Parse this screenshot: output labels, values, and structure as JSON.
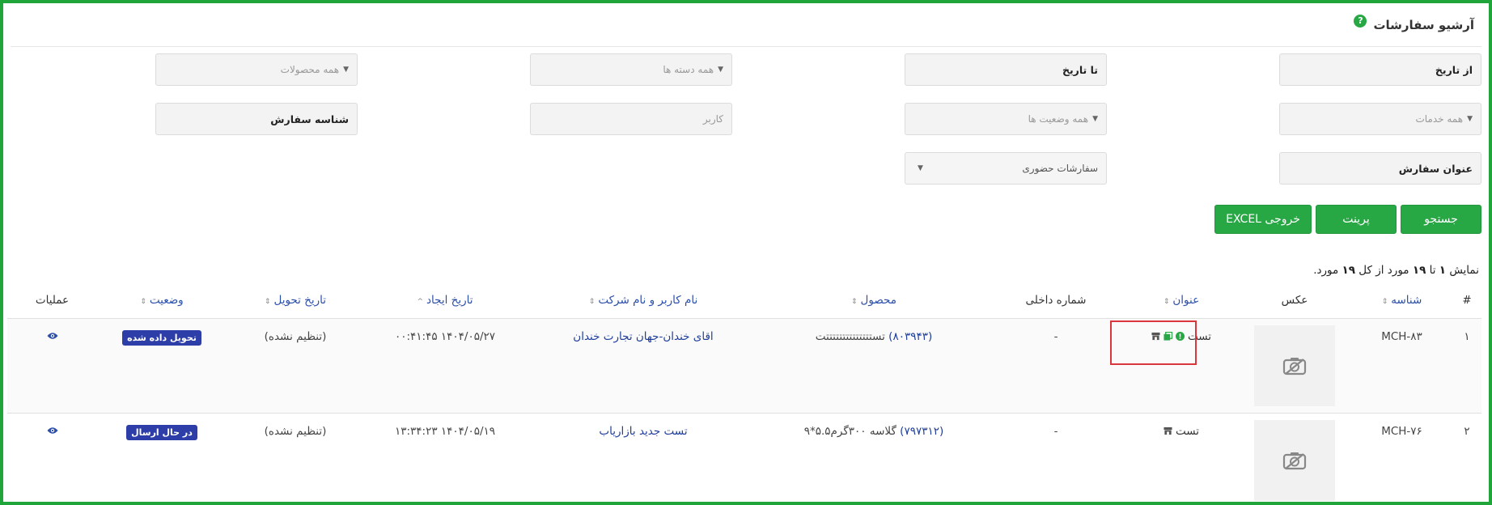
{
  "page": {
    "title": "آرشیو سفارشات",
    "help_icon": "?"
  },
  "filters": {
    "from_date": "از تاریخ",
    "to_date": "تا تاریخ",
    "categories": "همه دسته ها",
    "products": "همه محصولات",
    "services": "همه خدمات",
    "statuses": "همه وضعیت ها",
    "user": "کاربر",
    "order_id": "شناسه سفارش",
    "order_title": "عنوان سفارش",
    "order_type": "سفارشات حضوری"
  },
  "buttons": {
    "search": "جستجو",
    "print": "پرینت",
    "excel": "خروجی EXCEL"
  },
  "summary": {
    "prefix": "نمایش",
    "from": "۱",
    "to_word": "تا",
    "to": "۱۹",
    "mid": "مورد از کل",
    "total": "۱۹",
    "suffix": "مورد."
  },
  "table": {
    "headers": {
      "num": "#",
      "id": "شناسه",
      "photo": "عکس",
      "title": "عنوان",
      "internal_no": "شماره داخلی",
      "product": "محصول",
      "user_company": "نام کاربر و نام شرکت",
      "created": "تاریخ ایجاد",
      "delivery": "تاریخ تحویل",
      "status": "وضعیت",
      "actions": "عملیات"
    },
    "rows": [
      {
        "num": "۱",
        "id": "MCH-۸۳",
        "title": "تست",
        "internal_no": "-",
        "product_code": "(۸۰۳۹۴۳)",
        "product_name": "تستتتتتتتتتتتتتتت",
        "user_company": "اقای خندان-جهان تجارت خندان",
        "created": "۱۴۰۴/۰۵/۲۷ ۰۰:۴۱:۴۵",
        "delivery": "(تنظیم نشده)",
        "status": "تحویل داده شده"
      },
      {
        "num": "۲",
        "id": "MCH-۷۶",
        "title": "تست",
        "internal_no": "-",
        "product_code": "(۷۹۷۳۱۲)",
        "product_name": "گلاسه ۳۰۰گرم۵.۵*۹",
        "user_company": "تست جدید بازاریاب",
        "created": "۱۴۰۴/۰۵/۱۹ ۱۳:۳۴:۲۳",
        "delivery": "(تنظیم نشده)",
        "status": "در حال ارسال"
      }
    ]
  },
  "colors": {
    "accent": "#28a745",
    "frame": "#20a53a",
    "link": "#1e3d9a",
    "badge": "#2d3ea8",
    "highlight": "#d9363e"
  }
}
